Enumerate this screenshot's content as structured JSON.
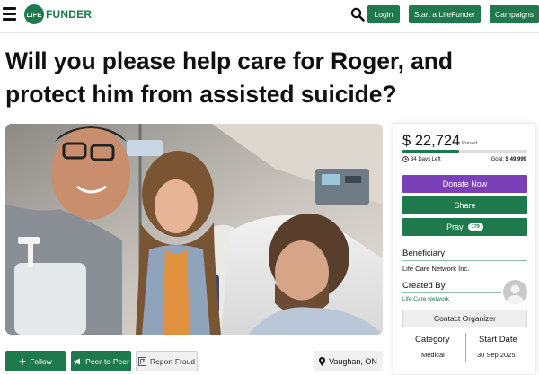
{
  "header": {
    "logo_badge": "LIFE",
    "logo_word": "FUNDER",
    "login_label": "Login",
    "start_label": "Start a LifeFunder",
    "campaigns_label": "Campaigns"
  },
  "campaign": {
    "title": "Will you please help care for Roger, and protect him from assisted suicide?"
  },
  "actions": {
    "follow_label": "Follow",
    "peer_label": "Peer-to-Peer",
    "report_label": "Report Fraud",
    "location": "Vaughan, ON"
  },
  "donation": {
    "raised_amount": "$ 22,724",
    "raised_label": "Raised:",
    "progress_fraction": 0.455,
    "days_left": "34 Days Left",
    "goal_label": "Goal:",
    "goal_value": "$ 49,999",
    "donate_label": "Donate Now",
    "share_label": "Share",
    "pray_label": "Pray",
    "pray_count": "179",
    "beneficiary_heading": "Beneficiary",
    "beneficiary_name": "Life Care Network Inc.",
    "created_heading": "Created By",
    "organizer_name": "Life Care Network",
    "contact_label": "Contact Organizer",
    "category_heading": "Category",
    "category_value": "Medical",
    "start_heading": "Start Date",
    "start_value": "30 Sep 2025"
  },
  "colors": {
    "brand_green": "#1e7a4c",
    "donate_purple": "#7b3fb8"
  },
  "icons": [
    "menu-icon",
    "search-icon",
    "plus-icon",
    "megaphone-icon",
    "flag-icon",
    "map-pin-icon",
    "clock-icon",
    "user-icon"
  ]
}
